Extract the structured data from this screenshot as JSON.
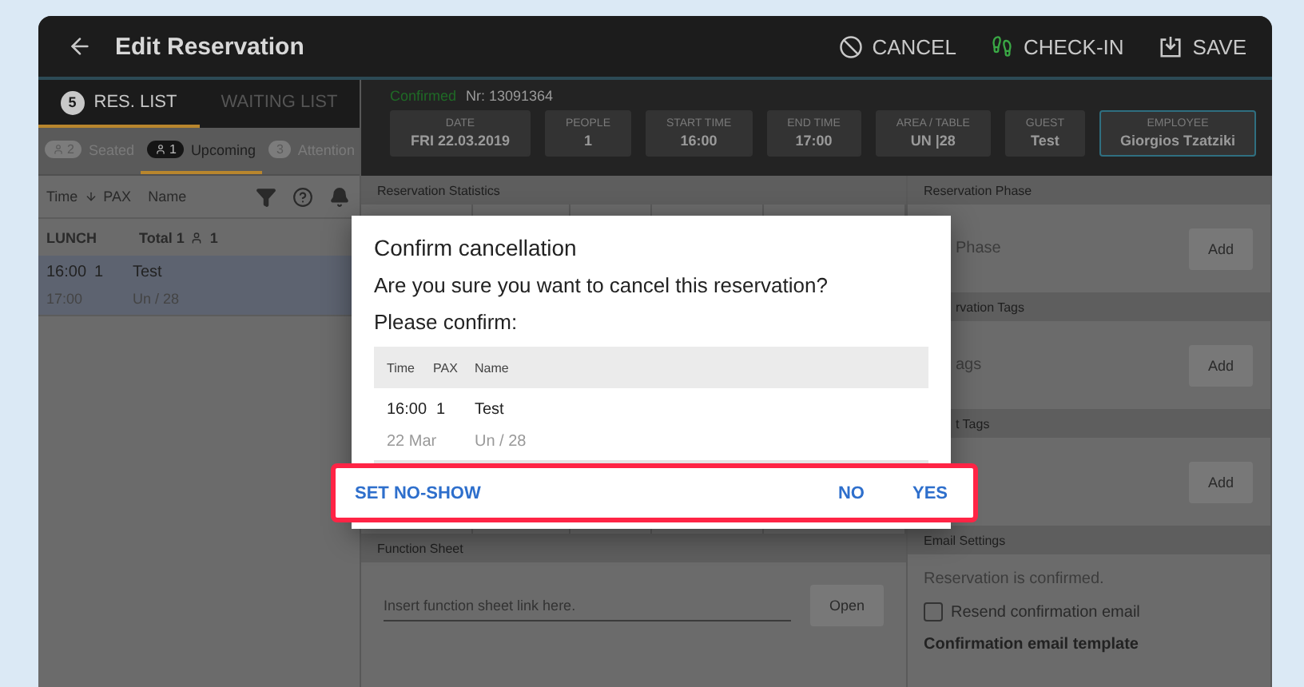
{
  "header": {
    "title": "Edit Reservation",
    "actions": [
      {
        "kind": "cancel",
        "label": "CANCEL"
      },
      {
        "kind": "checkin",
        "label": "CHECK-IN"
      },
      {
        "kind": "save",
        "label": "SAVE"
      }
    ]
  },
  "list_tabs": [
    {
      "label": "RES. LIST",
      "count": "5",
      "selected": true
    },
    {
      "label": "WAITING LIST",
      "selected": false
    }
  ],
  "filters": [
    {
      "label": "Seated",
      "count": "2",
      "selected": false
    },
    {
      "label": "Upcoming",
      "count": "1",
      "selected": true
    },
    {
      "label": "Attention",
      "count": "3",
      "selected": false
    }
  ],
  "list_columns": [
    "Time",
    "PAX",
    "Name"
  ],
  "group": {
    "name": "LUNCH",
    "total": "Total 1",
    "guests": "1"
  },
  "reservations": [
    {
      "time": "16:00",
      "pax": "1",
      "name": "Test",
      "end_time": "17:00",
      "table": "Un / 28",
      "selected": true
    }
  ],
  "reservation": {
    "status": "Confirmed",
    "number": "Nr: 13091364",
    "fields": [
      {
        "label": "DATE",
        "value": "FRI 22.03.2019",
        "selected": false
      },
      {
        "label": "PEOPLE",
        "value": "1",
        "selected": false
      },
      {
        "label": "START TIME",
        "value": "16:00",
        "selected": false
      },
      {
        "label": "END TIME",
        "value": "17:00",
        "selected": false
      },
      {
        "label": "AREA / TABLE",
        "value": "UN |28",
        "selected": false
      },
      {
        "label": "GUEST",
        "value": "Test",
        "selected": false
      },
      {
        "label": "EMPLOYEE",
        "value": "Giorgios Tzatziki",
        "selected": true
      }
    ]
  },
  "statistics": {
    "title": "Reservation Statistics"
  },
  "function_sheet": {
    "title": "Function Sheet",
    "placeholder": "Insert function sheet link here.",
    "button": "Open"
  },
  "side_sections": [
    {
      "title": "Reservation Phase",
      "text": "Phase",
      "button": "Add"
    },
    {
      "title": "rvation Tags",
      "text": "ags",
      "button": "Add"
    },
    {
      "title": "t Tags",
      "button": "Add"
    }
  ],
  "email_settings": {
    "title": "Email Settings",
    "status": "Reservation is confirmed.",
    "resend": {
      "label": "Resend confirmation email",
      "checked": false
    },
    "template_label": "Confirmation email template"
  },
  "dialog": {
    "title": "Confirm cancellation",
    "message": "Are you sure you want to cancel this reservation?",
    "prompt": "Please confirm:",
    "columns": [
      "Time",
      "PAX",
      "Name"
    ],
    "rows": [
      {
        "time": "16:00",
        "pax": "1",
        "name": "Test",
        "date": "22 Mar",
        "table": "Un / 28"
      }
    ],
    "actions": [
      {
        "label": "SET NO-SHOW"
      },
      {
        "label": "NO"
      },
      {
        "label": "YES"
      }
    ]
  }
}
